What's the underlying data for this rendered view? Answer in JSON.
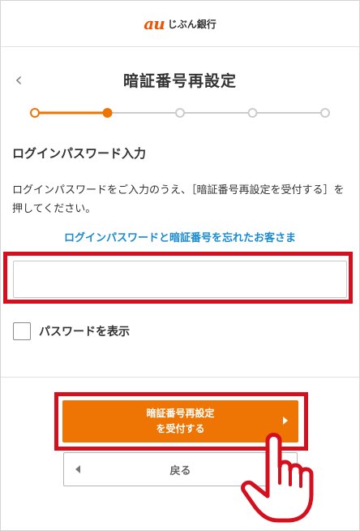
{
  "header": {
    "logo_mark": "au",
    "logo_text": "じぶん銀行"
  },
  "nav": {
    "back_glyph": "‹",
    "title": "暗証番号再設定"
  },
  "stepper": {
    "total_steps": 5,
    "current_step": 2,
    "active_color": "#ee7403",
    "inactive_color": "#cccccc"
  },
  "form": {
    "section_title": "ログインパスワード入力",
    "instructions": "ログインパスワードをご入力のうえ、［暗証番号再設定を受付する］を押してください。",
    "forgot_link": "ログインパスワードと暗証番号を忘れたお客さま",
    "password_value": "",
    "password_placeholder": "",
    "show_password_label": "パスワードを表示"
  },
  "actions": {
    "submit_line1": "暗証番号再設定",
    "submit_line2": "を受付する",
    "back_label": "戻る"
  },
  "colors": {
    "brand": "#eb5505",
    "button": "#ee7403",
    "link": "#1a8bd1",
    "highlight": "#d40f1e"
  },
  "icons": {
    "pointer": "hand-pointer-icon"
  }
}
